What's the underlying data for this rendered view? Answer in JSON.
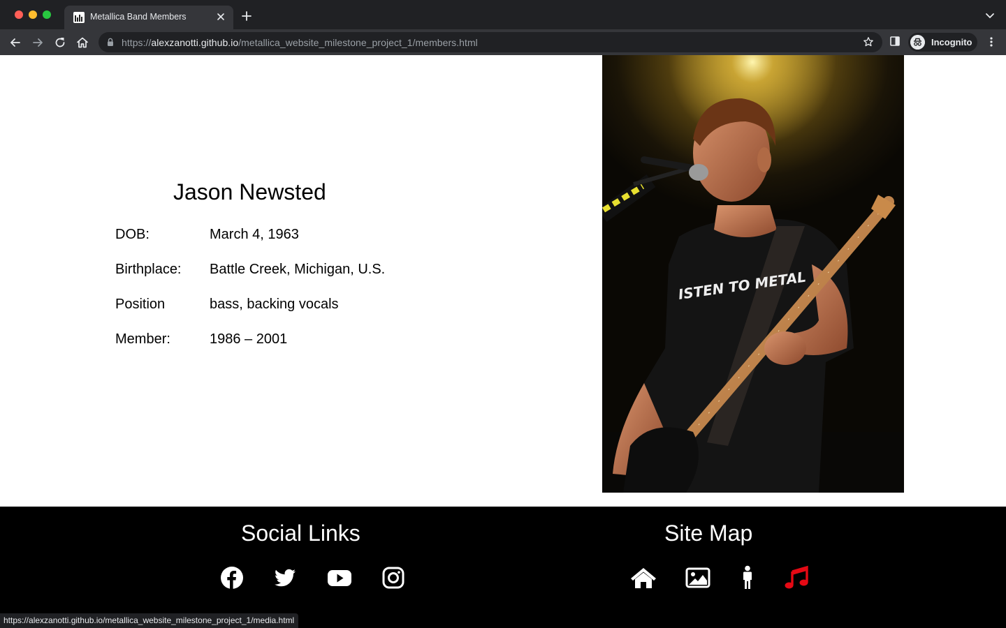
{
  "browser": {
    "tab_title": "Metallica Band Members",
    "url_scheme": "https://",
    "url_host": "alexzanotti.github.io",
    "url_path": "/metallica_website_milestone_project_1/members.html",
    "profile_label": "Incognito",
    "status_url": "https://alexzanotti.github.io/metallica_website_milestone_project_1/media.html"
  },
  "member": {
    "name": "Jason Newsted",
    "details": [
      {
        "label": "DOB:",
        "value": "March 4, 1963"
      },
      {
        "label": "Birthplace:",
        "value": "Battle Creek, Michigan, U.S."
      },
      {
        "label": "Position",
        "value": "bass, backing vocals"
      },
      {
        "label": "Member:",
        "value": "1986 – 2001"
      }
    ],
    "shirt_text": "ISTEN TO METAL"
  },
  "footer": {
    "social_title": "Social Links",
    "sitemap_title": "Site Map",
    "social_icons": [
      "facebook-icon",
      "twitter-icon",
      "youtube-icon",
      "instagram-icon"
    ],
    "sitemap_icons": [
      "home-icon",
      "image-icon",
      "person-icon",
      "music-note-icon"
    ],
    "active_color": "#e50914"
  }
}
